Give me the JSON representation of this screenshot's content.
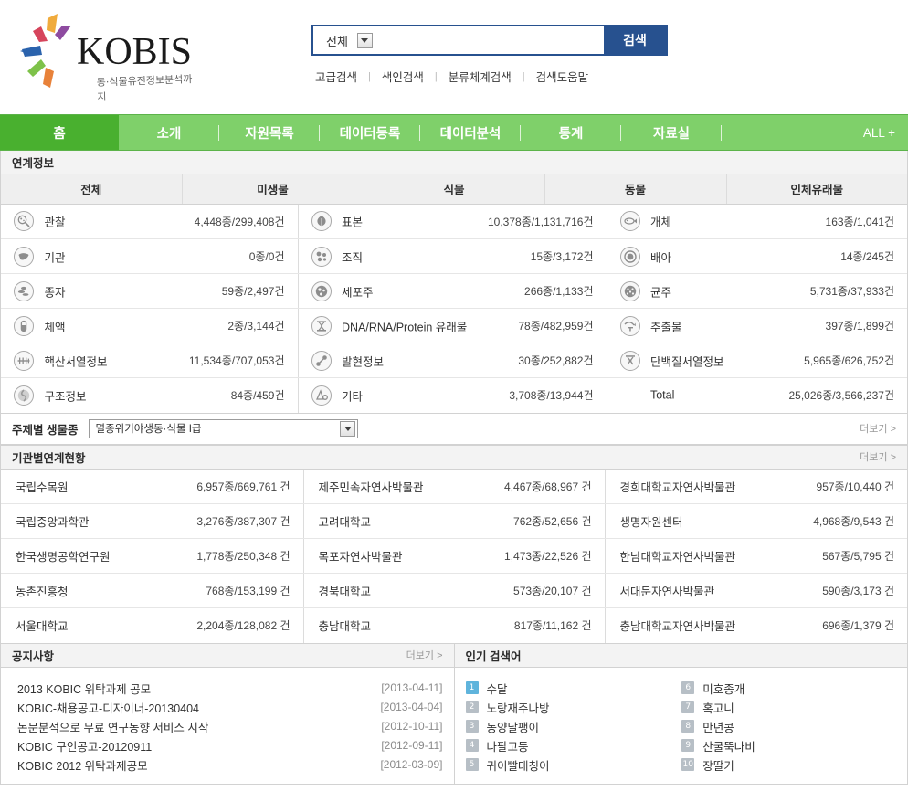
{
  "brand": {
    "name": "KOBIS",
    "tagline": "동·식물유전정보분석까지"
  },
  "search": {
    "category": "전체",
    "value": "",
    "placeholder": "",
    "button_label": "검색",
    "links": [
      "고급검색",
      "색인검색",
      "분류체계검색",
      "검색도움말"
    ]
  },
  "nav": {
    "items": [
      {
        "label": "홈",
        "active": true
      },
      {
        "label": "소개"
      },
      {
        "label": "자원목록"
      },
      {
        "label": "데이터등록"
      },
      {
        "label": "데이터분석"
      },
      {
        "label": "통계"
      },
      {
        "label": "자료실"
      }
    ],
    "all_label": "ALL +"
  },
  "linked_info": {
    "title": "연계정보",
    "columns": [
      "전체",
      "미생물",
      "식물",
      "동물",
      "인체유래물"
    ],
    "rows": [
      {
        "c1": {
          "icon": "observation-icon",
          "label": "관찰",
          "value": "4,448종/299,408건"
        },
        "c2": {
          "icon": "specimen-icon",
          "label": "표본",
          "value": "10,378종/1,131,716건"
        },
        "c3": {
          "icon": "individual-icon",
          "label": "개체",
          "value": "163종/1,041건"
        }
      },
      {
        "c1": {
          "icon": "organ-icon",
          "label": "기관",
          "value": "0종/0건"
        },
        "c2": {
          "icon": "tissue-icon",
          "label": "조직",
          "value": "15종/3,172건"
        },
        "c3": {
          "icon": "embryo-icon",
          "label": "배아",
          "value": "14종/245건"
        }
      },
      {
        "c1": {
          "icon": "seed-icon",
          "label": "종자",
          "value": "59종/2,497건"
        },
        "c2": {
          "icon": "cellline-icon",
          "label": "세포주",
          "value": "266종/1,133건"
        },
        "c3": {
          "icon": "strain-icon",
          "label": "균주",
          "value": "5,731종/37,933건"
        }
      },
      {
        "c1": {
          "icon": "bodyfluid-icon",
          "label": "체액",
          "value": "2종/3,144건"
        },
        "c2": {
          "icon": "dna-rna-protein-icon",
          "label": "DNA/RNA/Protein 유래물",
          "value": "78종/482,959건"
        },
        "c3": {
          "icon": "extract-icon",
          "label": "추출물",
          "value": "397종/1,899건"
        }
      },
      {
        "c1": {
          "icon": "nucleic-acid-sequence-icon",
          "label": "핵산서열정보",
          "value": "11,534종/707,053건"
        },
        "c2": {
          "icon": "expression-icon",
          "label": "발현정보",
          "value": "30종/252,882건"
        },
        "c3": {
          "icon": "protein-sequence-icon",
          "label": "단백질서열정보",
          "value": "5,965종/626,752건"
        }
      },
      {
        "c1": {
          "icon": "structure-icon",
          "label": "구조정보",
          "value": "84종/459건"
        },
        "c2": {
          "icon": "etc-icon",
          "label": "기타",
          "value": "3,708종/13,944건"
        },
        "c3": {
          "icon": "",
          "label": "Total",
          "value": "25,026종/3,566,237건"
        }
      }
    ]
  },
  "subject": {
    "label": "주제별 생물종",
    "selected": "멸종위기야생동·식물 I급",
    "more_label": "더보기 >"
  },
  "institutions": {
    "title": "기관별연계현황",
    "more_label": "더보기 >",
    "rows": [
      {
        "n1": "국립수목원",
        "v1": "6,957종/669,761 건",
        "n2": "제주민속자연사박물관",
        "v2": "4,467종/68,967 건",
        "n3": "경희대학교자연사박물관",
        "v3": "957종/10,440 건"
      },
      {
        "n1": "국립중앙과학관",
        "v1": "3,276종/387,307 건",
        "n2": "고려대학교",
        "v2": "762종/52,656 건",
        "n3": "생명자원센터",
        "v3": "4,968종/9,543 건"
      },
      {
        "n1": "한국생명공학연구원",
        "v1": "1,778종/250,348 건",
        "n2": "목포자연사박물관",
        "v2": "1,473종/22,526 건",
        "n3": "한남대학교자연사박물관",
        "v3": "567종/5,795 건"
      },
      {
        "n1": "농촌진흥청",
        "v1": "768종/153,199 건",
        "n2": "경북대학교",
        "v2": "573종/20,107 건",
        "n3": "서대문자연사박물관",
        "v3": "590종/3,173 건"
      },
      {
        "n1": "서울대학교",
        "v1": "2,204종/128,082 건",
        "n2": "충남대학교",
        "v2": "817종/11,162 건",
        "n3": "충남대학교자연사박물관",
        "v3": "696종/1,379 건"
      }
    ]
  },
  "notices": {
    "title": "공지사항",
    "more_label": "더보기 >",
    "items": [
      {
        "title": "2013 KOBIC 위탁과제 공모",
        "date": "[2013-04-11]"
      },
      {
        "title": "KOBIC-채용공고-디자이너-20130404",
        "date": "[2013-04-04]"
      },
      {
        "title": "논문분석으로 무료 연구동향 서비스 시작",
        "date": "[2012-10-11]"
      },
      {
        "title": "KOBIC 구인공고-20120911",
        "date": "[2012-09-11]"
      },
      {
        "title": "KOBIC 2012 위탁과제공모",
        "date": "[2012-03-09]"
      }
    ]
  },
  "keywords": {
    "title": "인기 검색어",
    "left": [
      {
        "rank": "1",
        "term": "수달"
      },
      {
        "rank": "2",
        "term": "노랑재주나방"
      },
      {
        "rank": "3",
        "term": "동양달팽이"
      },
      {
        "rank": "4",
        "term": "나팔고둥"
      },
      {
        "rank": "5",
        "term": "귀이빨대칭이"
      }
    ],
    "right": [
      {
        "rank": "6",
        "term": "미호종개"
      },
      {
        "rank": "7",
        "term": "혹고니"
      },
      {
        "rank": "8",
        "term": "만년콩"
      },
      {
        "rank": "9",
        "term": "산굴뚝나비"
      },
      {
        "rank": "10",
        "term": "장딸기"
      }
    ]
  },
  "colors": {
    "nav_green": "#7fd06a",
    "nav_home_green": "#49b02f",
    "search_blue": "#27518f",
    "rank_top": "#5fb4dc",
    "rank_normal": "#b7bfc6"
  }
}
